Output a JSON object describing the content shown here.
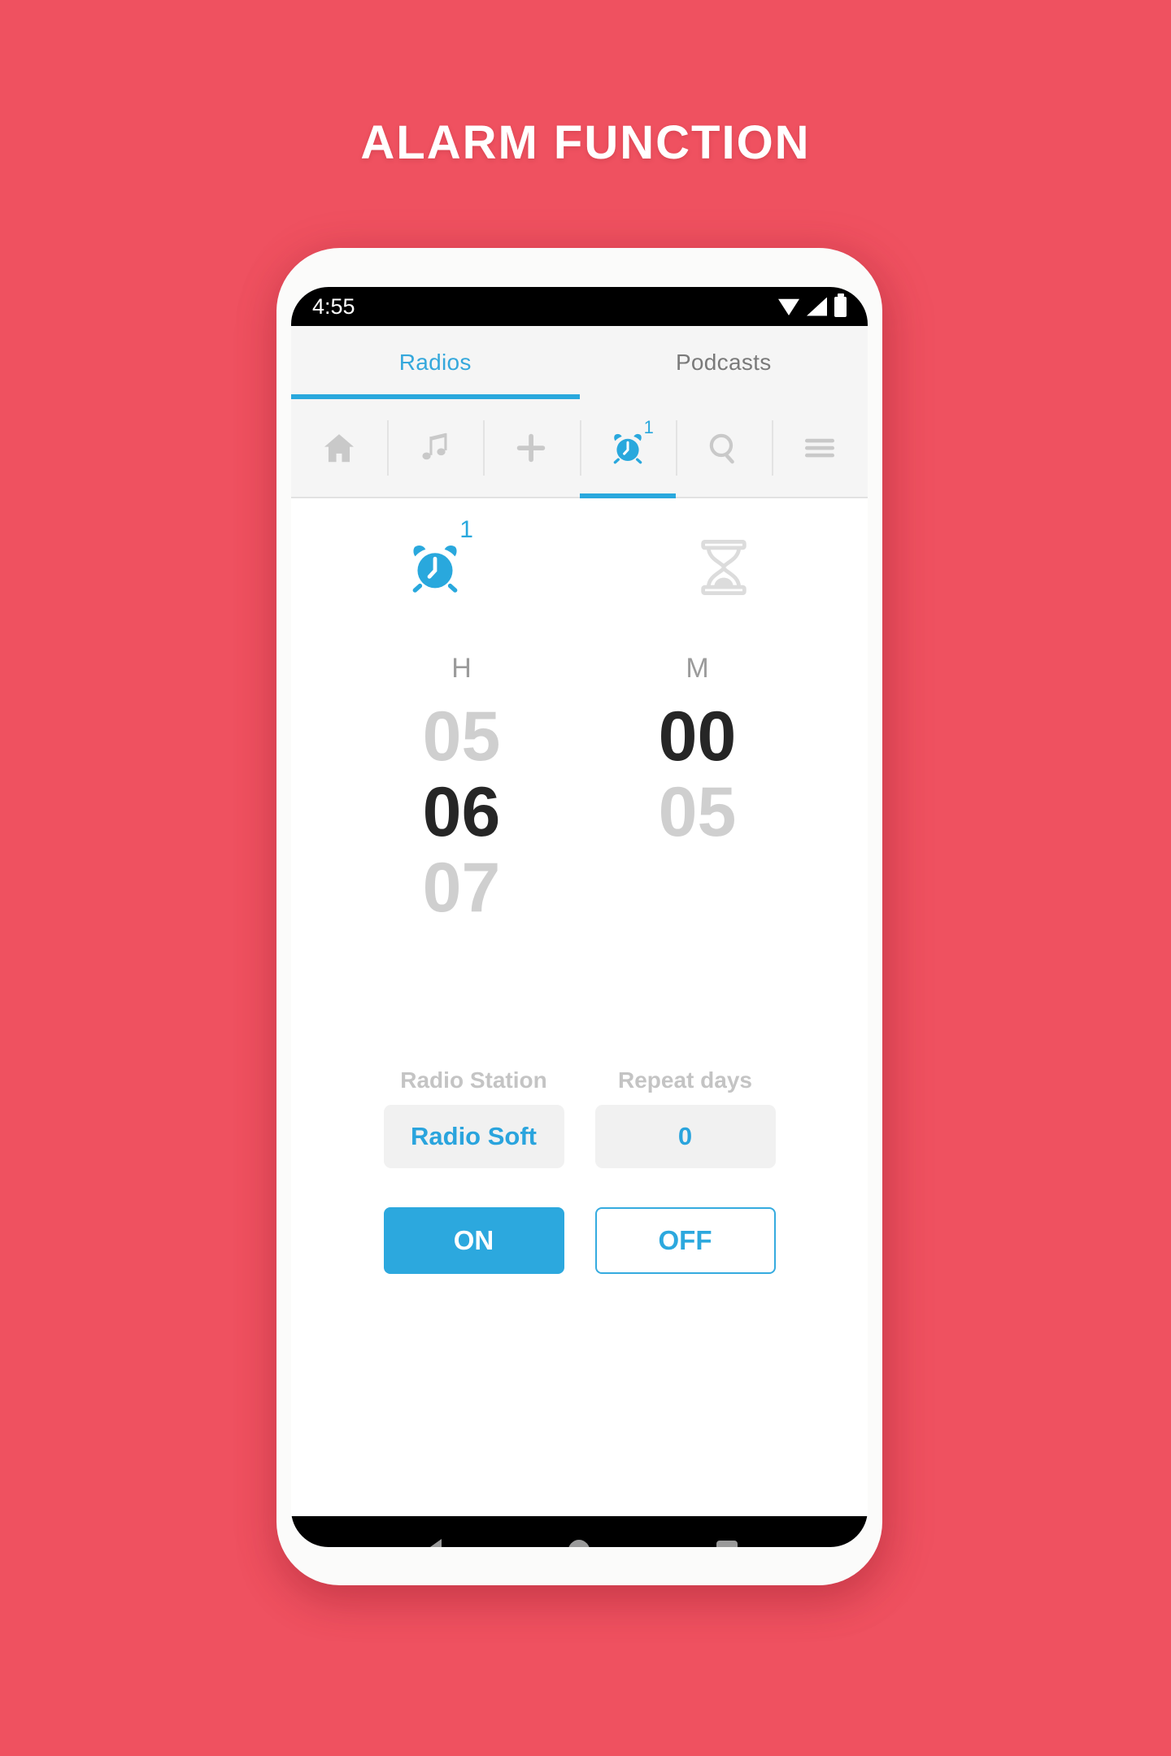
{
  "poster": {
    "title": "ALARM FUNCTION",
    "background_color": "#ef5160",
    "accent_color": "#29a8dd"
  },
  "statusbar": {
    "time": "4:55",
    "icons": [
      "wifi-icon",
      "signal-icon",
      "battery-icon"
    ]
  },
  "tabs": [
    {
      "label": "Radios",
      "active": true
    },
    {
      "label": "Podcasts",
      "active": false
    }
  ],
  "toolbar": {
    "items": [
      {
        "name": "home-icon",
        "active": false,
        "badge": ""
      },
      {
        "name": "music-note-icon",
        "active": false,
        "badge": ""
      },
      {
        "name": "plus-icon",
        "active": false,
        "badge": ""
      },
      {
        "name": "alarm-clock-icon",
        "active": true,
        "badge": "1"
      },
      {
        "name": "search-icon",
        "active": false,
        "badge": ""
      },
      {
        "name": "hamburger-menu-icon",
        "active": false,
        "badge": ""
      }
    ],
    "alarm_badge": "1"
  },
  "modes": [
    {
      "name": "alarm-clock-icon",
      "badge": "1",
      "active": true
    },
    {
      "name": "hourglass-timer-icon",
      "badge": "",
      "active": false
    }
  ],
  "picker": {
    "hours_label": "H",
    "minutes_label": "M",
    "hours": {
      "previous": "05",
      "selected": "06",
      "next": "07"
    },
    "minutes": {
      "previous": "",
      "selected": "00",
      "next": "05"
    }
  },
  "fields": [
    {
      "label": "Radio Station",
      "value": "Radio Soft"
    },
    {
      "label": "Repeat days",
      "value": "0"
    }
  ],
  "actions": [
    {
      "label": "ON",
      "style": "primary"
    },
    {
      "label": "OFF",
      "style": "outline"
    }
  ],
  "navbar": {
    "back": "back-triangle-icon",
    "home": "home-circle-icon",
    "recents": "recents-square-icon"
  }
}
